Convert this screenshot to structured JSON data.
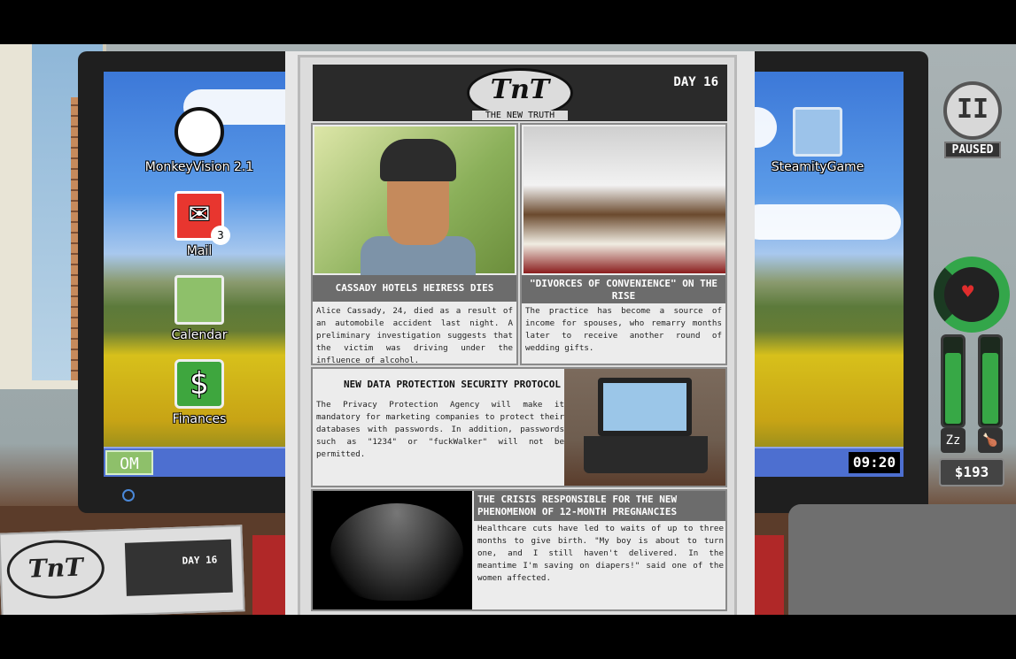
{
  "desktop": {
    "icons": [
      {
        "label": "MonkeyVision 2.1",
        "icon": "monkey-eye-icon"
      },
      {
        "label": "Mail",
        "icon": "envelope-icon",
        "badge": "3"
      },
      {
        "label": "Calendar",
        "icon": "calendar-icon"
      },
      {
        "label": "Finances",
        "icon": "dollar-icon"
      },
      {
        "label": "SteamityGame",
        "icon": "grid-game-icon"
      }
    ],
    "taskbar": {
      "start_label": "OM",
      "clock": "09:20"
    }
  },
  "newspaper": {
    "logo": "TnT",
    "subtitle": "THE NEW TRUTH",
    "day": "DAY 16",
    "articles": [
      {
        "headline": "CASSADY HOTELS HEIRESS DIES",
        "body": "Alice Cassady, 24, died as a result of an automobile accident last night. A preliminary investigation suggests that the victim was driving under the influence of alcohol."
      },
      {
        "headline": "\"DIVORCES OF CONVENIENCE\" ON THE RISE",
        "body": "The practice has become a source of income for spouses, who remarry months later to receive another round of wedding gifts."
      },
      {
        "headline": "NEW DATA PROTECTION SECURITY PROTOCOL",
        "body": "The Privacy Protection Agency will make it mandatory for marketing companies to protect their databases with passwords. In addition, passwords such as \"1234\" or \"fuckWalker\" will not be permitted."
      },
      {
        "headline": "THE CRISIS RESPONSIBLE FOR THE NEW PHENOMENON OF 12-MONTH PREGNANCIES",
        "body": "Healthcare cuts have led to waits of up to three months to give birth. \"My boy is about to turn one, and I still haven't delivered. In the meantime I'm saving on diapers!\" said one of the women affected."
      }
    ]
  },
  "hud": {
    "pause_symbol": "II",
    "paused_label": "PAUSED",
    "health_level": 0.75,
    "sleep_level": 0.8,
    "food_level": 0.8,
    "sleep_icon": "Zz",
    "food_icon": "drumstick-icon",
    "money": "$193"
  },
  "desk_paper": {
    "logo": "TnT",
    "day": "DAY 16"
  }
}
